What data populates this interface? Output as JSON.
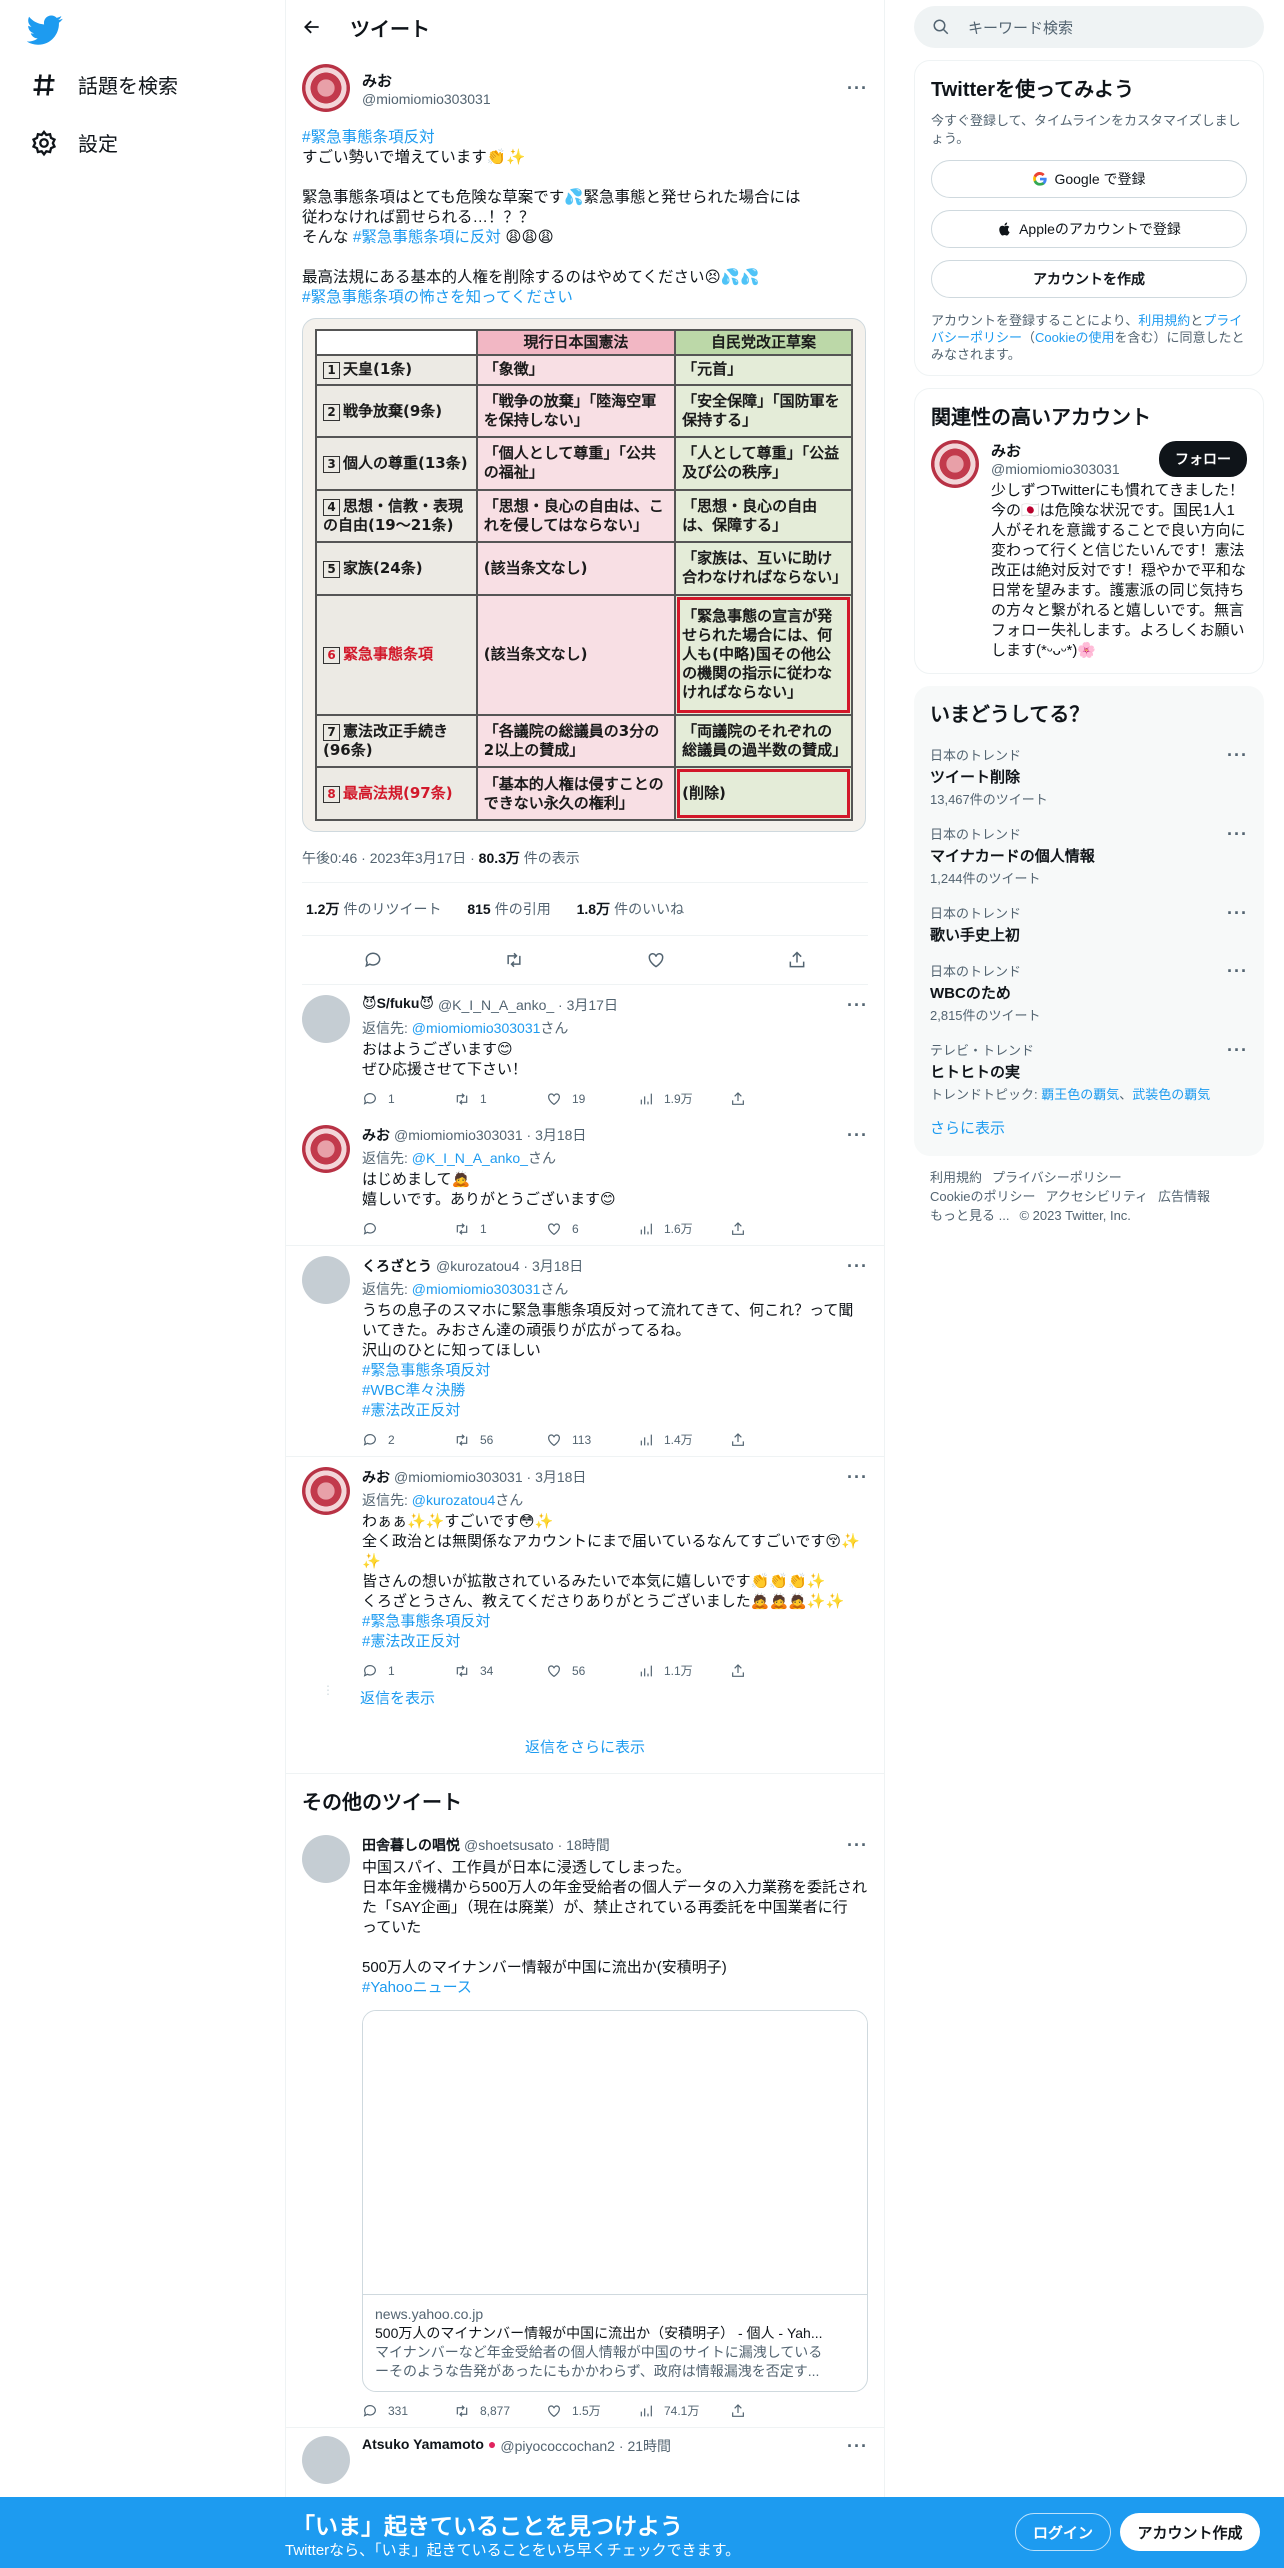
{
  "nav": {
    "explore_label": "話題を検索",
    "settings_label": "設定"
  },
  "header": {
    "title": "ツイート"
  },
  "main_tweet": {
    "author_name": "みお",
    "author_handle": "@miomiomio303031",
    "line1": "#緊急事態条項反対",
    "line2": "すごい勢いで増えています👏✨",
    "line3": "緊急事態条項はとても危険な草案です💦緊急事態と発せられた場合には",
    "line4": "従わなければ罰せられる…！？？",
    "line5_text": "そんな ",
    "line5_tag": "#緊急事態条項に反対",
    "line5_emoji": " 😩😩😩",
    "line6": "最高法規にある基本的人権を削除するのはやめてください😣💦💦",
    "line7": "#緊急事態条項の怖さを知ってください",
    "image_table": {
      "header": [
        "",
        "現行日本国憲法",
        "自民党改正草案"
      ],
      "rows": [
        {
          "n": "1",
          "label": "天皇(1条)",
          "current": "「象徴」",
          "draft": "「元首」"
        },
        {
          "n": "2",
          "label": "戦争放棄(9条)",
          "current": "「戦争の放棄」「陸海空軍を保持しない」",
          "draft": "「安全保障」「国防軍を保持する」"
        },
        {
          "n": "3",
          "label": "個人の尊重(13条)",
          "current": "「個人として尊重」「公共の福祉」",
          "draft": "「人として尊重」「公益及び公の秩序」"
        },
        {
          "n": "4",
          "label": "思想・信教・表現の自由(19〜21条)",
          "current": "「思想・良心の自由は、これを侵してはならない」",
          "draft": "「思想・良心の自由は、保障する」"
        },
        {
          "n": "5",
          "label": "家族(24条)",
          "current": "(該当条文なし)",
          "draft": "「家族は、互いに助け合わなければならない」"
        },
        {
          "n": "6",
          "label": "緊急事態条項",
          "current": "(該当条文なし)",
          "draft": "「緊急事態の宣言が発せられた場合には、何人も(中略)国その他公の機関の指示に従わなければならない」"
        },
        {
          "n": "7",
          "label": "憲法改正手続き(96条)",
          "current": "「各議院の総議員の3分の2以上の賛成」",
          "draft": "「両議院のそれぞれの総議員の過半数の賛成」"
        },
        {
          "n": "8",
          "label": "最高法規(97条)",
          "current": "「基本的人権は侵すことのできない永久の権利」",
          "draft": "(削除)"
        }
      ]
    },
    "time": "午後0:46",
    "date": "2023年3月17日",
    "views_num": "80.3万",
    "views_label": " 件の表示",
    "retweets_num": "1.2万",
    "retweets_label": "件のリツイート",
    "quotes_num": "815",
    "quotes_label": "件の引用",
    "likes_num": "1.8万",
    "likes_label": "件のいいね"
  },
  "replies": [
    {
      "name": "😈S/fuku😈",
      "handle": "@K_I_N_A_anko_",
      "date": "3月17日",
      "to_prefix": "返信先: ",
      "to_handle": "@miomiomio303031",
      "to_suffix": "さん",
      "lines": [
        "おはようございます😊",
        "ぜひ応援させて下さい！"
      ],
      "reply": "1",
      "rt": "1",
      "like": "19",
      "views": "1.9万"
    },
    {
      "name": "みお",
      "handle": "@miomiomio303031",
      "date": "3月18日",
      "to_prefix": "返信先: ",
      "to_handle": "@K_I_N_A_anko_",
      "to_suffix": "さん",
      "lines": [
        "はじめまして🙇",
        "嬉しいです。ありがとうございます😊"
      ],
      "reply": "",
      "rt": "1",
      "like": "6",
      "views": "1.6万"
    },
    {
      "name": "くろざとう",
      "handle": "@kurozatou4",
      "date": "3月18日",
      "to_prefix": "返信先: ",
      "to_handle": "@miomiomio303031",
      "to_suffix": "さん",
      "lines": [
        "うちの息子のスマホに緊急事態条項反対って流れてきて、何これ？って聞",
        "いてきた。みおさん達の頑張りが広がってるね。",
        "沢山のひとに知ってほしい"
      ],
      "tags": [
        "#緊急事態条項反対",
        "#WBC準々決勝",
        "#憲法改正反対"
      ],
      "reply": "2",
      "rt": "56",
      "like": "113",
      "views": "1.4万"
    },
    {
      "name": "みお",
      "handle": "@miomiomio303031",
      "date": "3月18日",
      "to_prefix": "返信先: ",
      "to_handle": "@kurozatou4",
      "to_suffix": "さん",
      "lines": [
        "わぁぁ✨✨すごいです😳✨",
        "全く政治とは無関係なアカウントにまで届いているなんてすごいです😚✨",
        "✨",
        "皆さんの想いが拡散されているみたいで本気に嬉しいです👏👏👏✨",
        "くろざとうさん、教えてくださりありがとうございました🙇🙇🙇✨✨"
      ],
      "tags": [
        "#緊急事態条項反対",
        "#憲法改正反対"
      ],
      "reply": "1",
      "rt": "34",
      "like": "56",
      "views": "1.1万"
    }
  ],
  "show_replies_label": "返信を表示",
  "show_more_replies_label": "返信をさらに表示",
  "other_tweets_title": "その他のツイート",
  "other_tweet": {
    "name": "田舎暮しの唱悦",
    "handle": "@shoetsusato",
    "time": "18時間",
    "lines": [
      "中国スパイ、工作員が日本に浸透してしまった。",
      "日本年金機構から500万人の年金受給者の個人データの入力業務を委託され",
      "た「SAY企画」（現在は廃業）が、禁止されている再委託を中国業者に行",
      "っていた",
      "",
      "500万人のマイナンバー情報が中国に流出か(安積明子)"
    ],
    "tag": "#Yahooニュース",
    "card_domain": "news.yahoo.co.jp",
    "card_title": "500万人のマイナンバー情報が中国に流出か（安積明子） - 個人 - Yah...",
    "card_desc1": "マイナンバーなど年金受給者の個人情報が中国のサイトに漏洩している",
    "card_desc2": "ーそのような告発があったにもかかわらず、政府は情報漏洩を否定す...",
    "reply": "331",
    "rt": "8,877",
    "like": "1.5万",
    "views": "74.1万"
  },
  "next_tweet": {
    "name": "Atsuko Yamamoto",
    "handle": "@piyococcochan2",
    "time": "21時間"
  },
  "right": {
    "search_placeholder": "キーワード検索",
    "signup_title": "Twitterを使ってみよう",
    "signup_sub": "今すぐ登録して、タイムラインをカスタマイズしましょう。",
    "google_btn": "Google で登録",
    "apple_btn": "Appleのアカウントで登録",
    "create_btn": "アカウントを作成",
    "terms_prefix": "アカウントを登録することにより、",
    "terms_link": "利用規約",
    "terms_mid": "と",
    "privacy_link": "プライバシーポリシー",
    "cookie_open": "（",
    "cookie_link": "Cookieの使用",
    "cookie_close": "を含む）に同意したとみなされます。",
    "related_title": "関連性の高いアカウント",
    "related_name": "みお",
    "related_handle": "@miomiomio303031",
    "follow_label": "フォロー",
    "related_bio": "少しずつTwitterにも慣れてきました！今の🇯🇵は危険な状況です。国民1人1人がそれを意識することで良い方向に変わって行くと信じたいんです！憲法改正は絶対反対です！穏やかで平和な日常を望みます。護憲派の同じ気持ちの方々と繋がれると嬉しいです。無言フォロー失礼します。よろしくお願いします(*ᵕᴗᵕ*)🌸",
    "trends_title": "いまどうしてる？",
    "trends": [
      {
        "ctx": "日本のトレンド",
        "title": "ツイート削除",
        "count": "13,467件のツイート"
      },
      {
        "ctx": "日本のトレンド",
        "title": "マイナカードの個人情報",
        "count": "1,244件のツイート"
      },
      {
        "ctx": "日本のトレンド",
        "title": "歌い手史上初",
        "count": ""
      },
      {
        "ctx": "日本のトレンド",
        "title": "WBCのため",
        "count": "2,815件のツイート"
      },
      {
        "ctx": "テレビ・トレンド",
        "title": "ヒトヒトの実",
        "count": ""
      }
    ],
    "trend5_topic_prefix": "トレンドトピック: ",
    "trend5_topic1": "覇王色の覇気",
    "trend5_topic_sep": "、",
    "trend5_topic2": "武装色の覇気",
    "show_more": "さらに表示",
    "footer1": "利用規約",
    "footer2": "プライバシーポリシー",
    "footer3": "Cookieのポリシー",
    "footer4": "アクセシビリティ",
    "footer5": "広告情報",
    "footer6": "もっと見る ...",
    "copyright": "© 2023 Twitter, Inc."
  },
  "bottom_bar": {
    "title": "「いま」起きていることを見つけよう",
    "sub": "Twitterなら、「いま」起きていることをいち早くチェックできます。",
    "login": "ログイン",
    "signup": "アカウント作成"
  },
  "colors": {
    "accent": "#1d9bf0",
    "text": "#0f1419",
    "muted": "#536471"
  }
}
